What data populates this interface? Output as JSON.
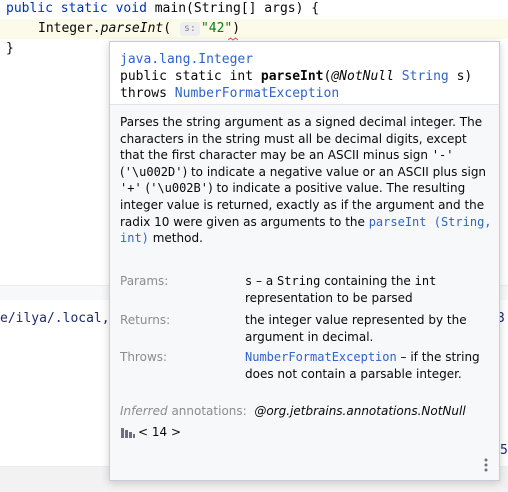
{
  "editor": {
    "line1": {
      "kw_public": "public",
      "kw_static": "static",
      "kw_void": "void",
      "rest": " main(String[] args) {"
    },
    "line2": {
      "prefix": "Integer.",
      "method": "parseInt",
      "open_paren": "(",
      "param_hint": "s:",
      "arg": "\"42\"",
      "close_paren": ")"
    },
    "line3": "}"
  },
  "terminal": {
    "path_fragment": "e/ilya/.local,",
    "right_fragment": "3",
    "right_fragment2": "5"
  },
  "doc": {
    "class_name": "java.lang.Integer",
    "signature": {
      "pre": "public static int ",
      "name": "parseInt",
      "paren_open": "(",
      "annotation": "@NotNull",
      "param_type": "String",
      "param_name": " s)",
      "throws_kw": "throws ",
      "exception": "NumberFormatException"
    },
    "description": {
      "t1": "Parses the string argument as a signed decimal integer. The characters in the string must all be decimal digits, except that the first character may be an ASCII minus sign ",
      "c1": "'-'",
      "t2": " (",
      "c2": "'\\u002D'",
      "t3": ") to indicate a negative value or an ASCII plus sign ",
      "c3": "'+'",
      "t4": " (",
      "c4": "'\\u002B'",
      "t5": ") to indicate a positive value. The resulting integer value is returned, exactly as if the argument and the radix 10 were given as arguments to the ",
      "link": "parseInt (String, int)",
      "t6": " method."
    },
    "params": {
      "label": "Params:",
      "name": "s",
      "dash": " – a ",
      "code": "String",
      "mid": " containing the ",
      "code2": "int",
      "end": " representation to be parsed"
    },
    "returns": {
      "label": "Returns:",
      "text": "the integer value represented by the argument in decimal."
    },
    "throws": {
      "label": "Throws:",
      "exception": "NumberFormatException",
      "text": " – if the string does not contain a parsable integer."
    },
    "inferred": {
      "label_italic": "Inferred",
      "label_rest": " annotations:",
      "value": "@org.jetbrains.annotations.NotNull"
    },
    "jdk": {
      "label": "< 14 >",
      "icon": "library-bars-icon"
    },
    "more_icon": "vertical-ellipsis-icon"
  },
  "colors": {
    "keyword": "#0033b3",
    "string": "#067d17",
    "link": "#2f65ca",
    "muted": "#8c8c8c",
    "popup_bg": "#f7f8fa",
    "terminal_text": "#1d2a6f"
  }
}
